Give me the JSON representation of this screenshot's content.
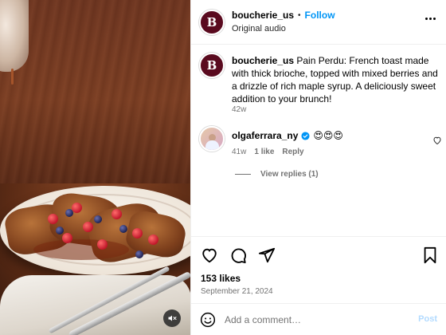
{
  "header": {
    "avatar_letter": "B",
    "username": "boucherie_us",
    "separator": "•",
    "follow_label": "Follow",
    "audio_label": "Original audio"
  },
  "caption": {
    "avatar_letter": "B",
    "username": "boucherie_us",
    "text": "Pain Perdu: French toast made with thick brioche, topped with mixed berries and a drizzle of rich maple syrup. A deliciously sweet addition to your brunch!",
    "time": "42w"
  },
  "comment": {
    "username": "olgaferrara_ny",
    "emojis": "😍😍😍",
    "time": "41w",
    "likes": "1 like",
    "reply_label": "Reply",
    "view_replies": "View replies (1)"
  },
  "post": {
    "likes": "153 likes",
    "date": "September 21, 2024"
  },
  "add_comment": {
    "placeholder": "Add a comment…",
    "post_label": "Post"
  },
  "colors": {
    "accent": "#0095f6",
    "muted": "#737373",
    "border": "#efefef",
    "post_disabled": "#b3dbff"
  },
  "icons": {
    "mute": "speaker-muted-icon",
    "more": "more-options-icon",
    "heart": "heart-icon",
    "comment": "comment-icon",
    "share": "share-icon",
    "bookmark": "bookmark-icon",
    "emoji": "emoji-icon",
    "verified": "verified-badge-icon"
  }
}
